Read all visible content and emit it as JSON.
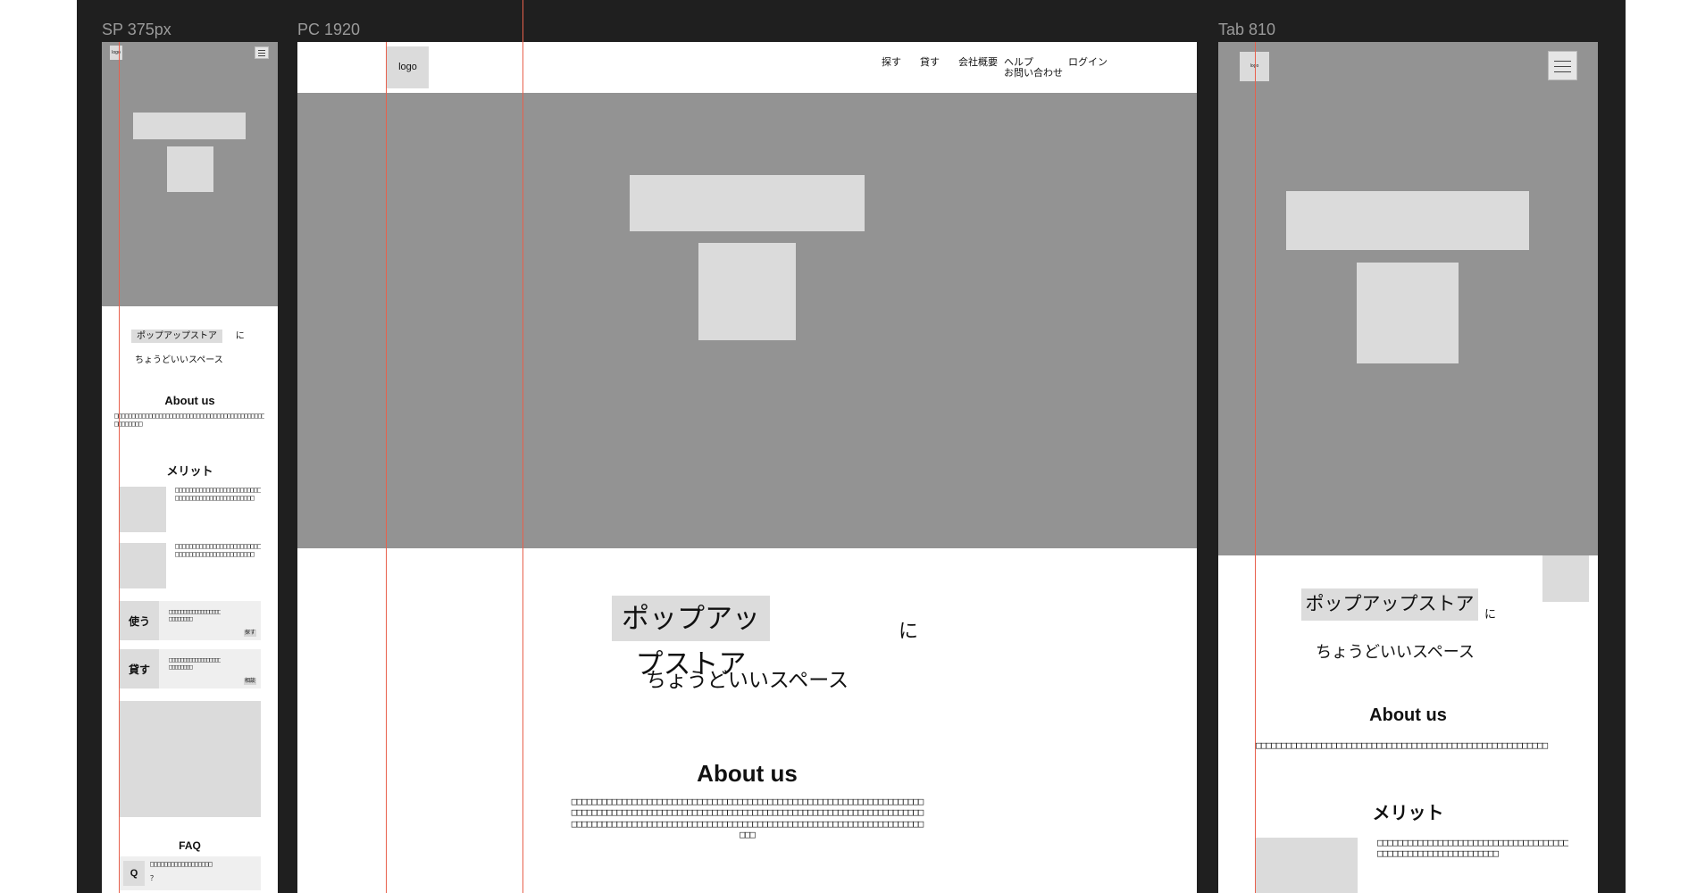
{
  "labels": {
    "sp": "SP 375px",
    "pc": "PC 1920",
    "tab": "Tab 810"
  },
  "logo": "logo",
  "logo_small": "logo",
  "nav": [
    "探す",
    "貸す",
    "会社概要",
    "ヘルプ\nお問い合わせ",
    "ログイン"
  ],
  "hero": {
    "highlight": "ポップアップストア",
    "particle": "に",
    "sub": "ちょうどいいスペース"
  },
  "about": {
    "title": "About us",
    "body": "□□□□□□□□□□□□□□□□□□□□□□□□□□□□□□□□□□□□□□□□□□□□□□□□□□□□□□□□□□□□□□□□□□□□□□□□□□□□□□□□□□□□□□□□□□□□□□□□□□□□□□□□□□□□□□□□□□□□□□□□□□□□□□□□□□□□□□□□□□□□□□□□□□□□□□□□□□□□□□□□□□□□□□□□□□□□□□□□□□□□□□□□□□□□□□□□□□□□□□□□□□□□□□□□□□□□□"
  },
  "about_sp": "□□□□□□□□□□□□□□□□□□□□□□□□□□□□□□□□□□□□□□□□□□□□□□□□□□□□",
  "about_tab": "□□□□□□□□□□□□□□□□□□□□□□□□□□□□□□□□□□□□□□□□□□□□□□□□□□□□□□□□□□",
  "merit": {
    "title": "メリット",
    "text": "□□□□□□□□□□□□□□□□□□□□□□□□□□□□□□□□□□□□□□□□□□□□□□□□"
  },
  "merit_tab": "□□□□□□□□□□□□□□□□□□□□□□□□□□□□□□□□□□□□□□□□□□□□□□□□□□□□□□□□□□□□□□",
  "cta": [
    {
      "label": "使う",
      "text": "□□□□□□□□□□□□□□□□□□□□□□□□□□",
      "button": "探す"
    },
    {
      "label": "貸す",
      "text": "□□□□□□□□□□□□□□□□□□□□□□□□□□",
      "button": "相談"
    }
  ],
  "faq": {
    "title": "FAQ",
    "q": "Q",
    "text": "□□□□□□□□□□□□□□□□□□",
    "suffix": "？"
  }
}
